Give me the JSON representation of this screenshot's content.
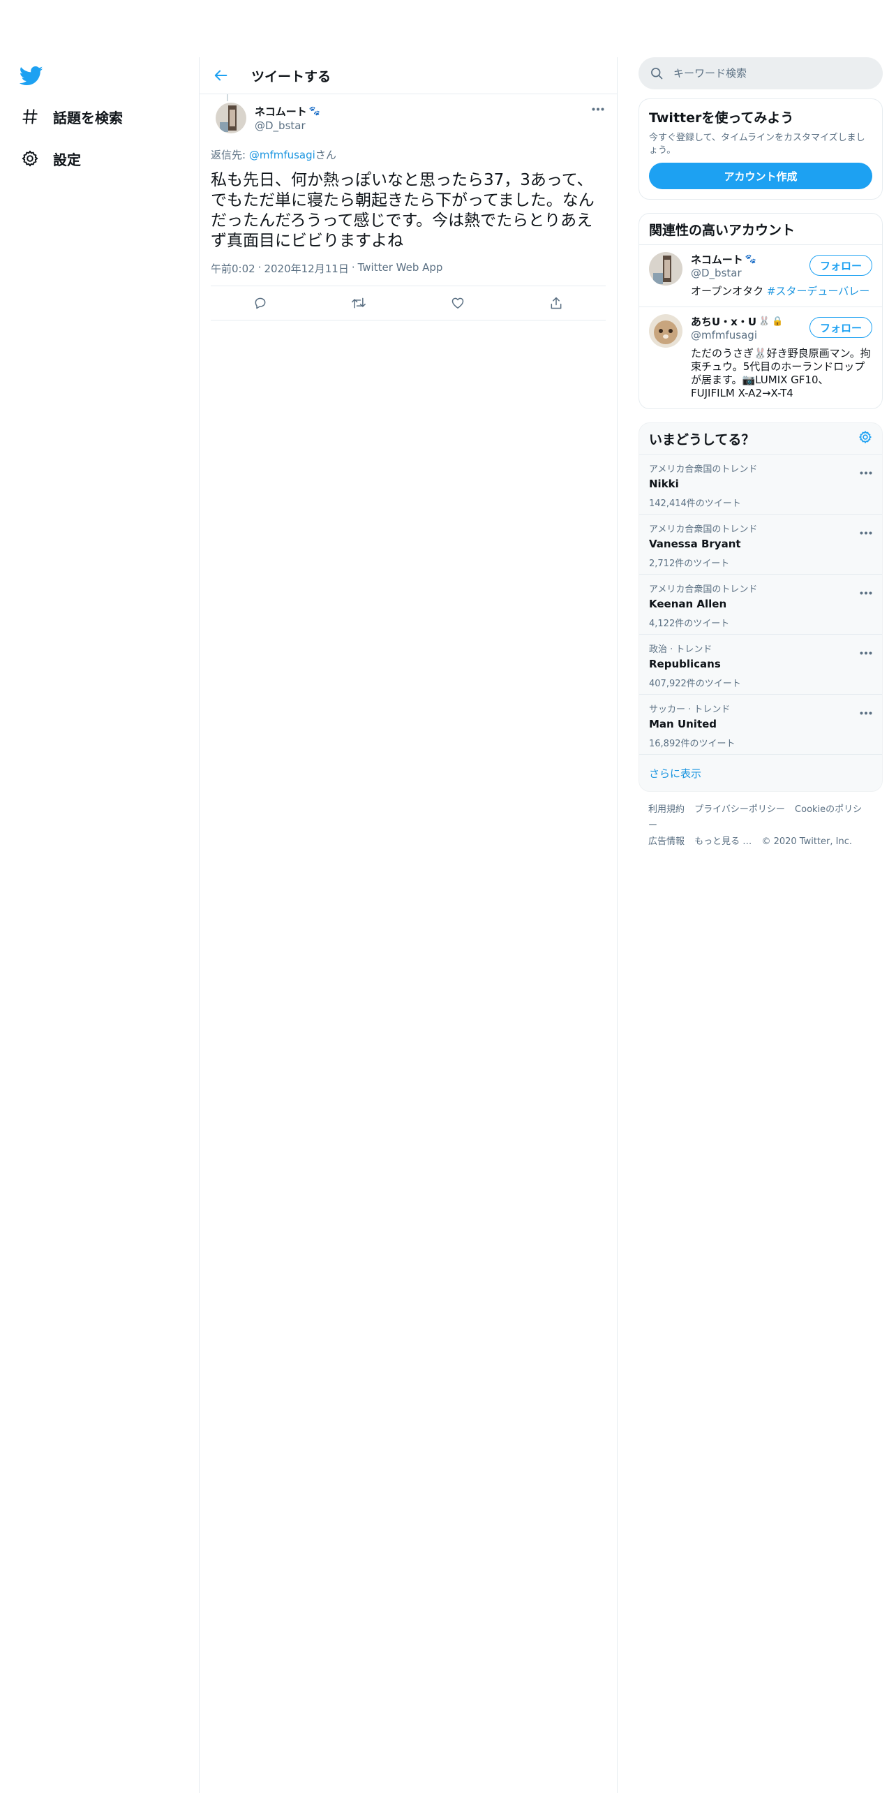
{
  "nav": {
    "logo_icon": "twitter-bird-icon",
    "items": [
      {
        "icon": "hashtag-icon",
        "label": "話題を検索"
      },
      {
        "icon": "gear-icon",
        "label": "設定"
      }
    ]
  },
  "header": {
    "title": "ツイートする"
  },
  "tweet": {
    "name": "ネコムート",
    "handle": "@D_bstar",
    "reply_prefix": "返信先: ",
    "reply_mention": "@mfmfusagi",
    "reply_suffix": "さん",
    "text": "私も先日、何か熱っぽいなと思ったら37，3あって、でもただ単に寝たら朝起きたら下がってました。なんだったんだろうって感じです。今は熱でたらとりあえず真面目にビビりますよね",
    "time": "午前0:02",
    "date": "2020年12月11日",
    "source": "Twitter Web App",
    "sep": "·"
  },
  "search": {
    "placeholder": "キーワード検索"
  },
  "signup": {
    "title": "Twitterを使ってみよう",
    "text": "今すぐ登録して、タイムラインをカスタマイズしましょう。",
    "button": "アカウント作成"
  },
  "relevant": {
    "title": "関連性の高いアカウント",
    "follow_label": "フォロー",
    "accounts": [
      {
        "name": "ネコムート",
        "handle": "@D_bstar",
        "bio": "オープンオタク ",
        "bio_tag": "#スターデューバレー"
      },
      {
        "name": "あちU・x・U",
        "handle": "@mfmfusagi",
        "bio": "ただのうさぎ🐰好き野良原画マン。拘束チュウ。5代目のホーランドロップが居ます。📷LUMIX GF10、FUJIFILM X-A2→X-T4",
        "bio_tag": ""
      }
    ]
  },
  "trends": {
    "title": "いまどうしてる？",
    "items": [
      {
        "context": "アメリカ合衆国のトレンド",
        "name": "Nikki",
        "count": "142,414件のツイート"
      },
      {
        "context": "アメリカ合衆国のトレンド",
        "name": "Vanessa Bryant",
        "count": "2,712件のツイート"
      },
      {
        "context": "アメリカ合衆国のトレンド",
        "name": "Keenan Allen",
        "count": "4,122件のツイート"
      },
      {
        "context": "政治 · トレンド",
        "name": "Republicans",
        "count": "407,922件のツイート"
      },
      {
        "context": "サッカー · トレンド",
        "name": "Man United",
        "count": "16,892件のツイート"
      }
    ],
    "show_more": "さらに表示"
  },
  "footer": {
    "links": [
      "利用規約",
      "プライバシーポリシー",
      "Cookieのポリシー",
      "広告情報",
      "もっと見る …"
    ],
    "copyright": "© 2020 Twitter, Inc."
  },
  "colors": {
    "accent": "#1da1f2",
    "link": "#1b95e0",
    "muted": "#5b7083",
    "border": "#e6ecf0"
  }
}
